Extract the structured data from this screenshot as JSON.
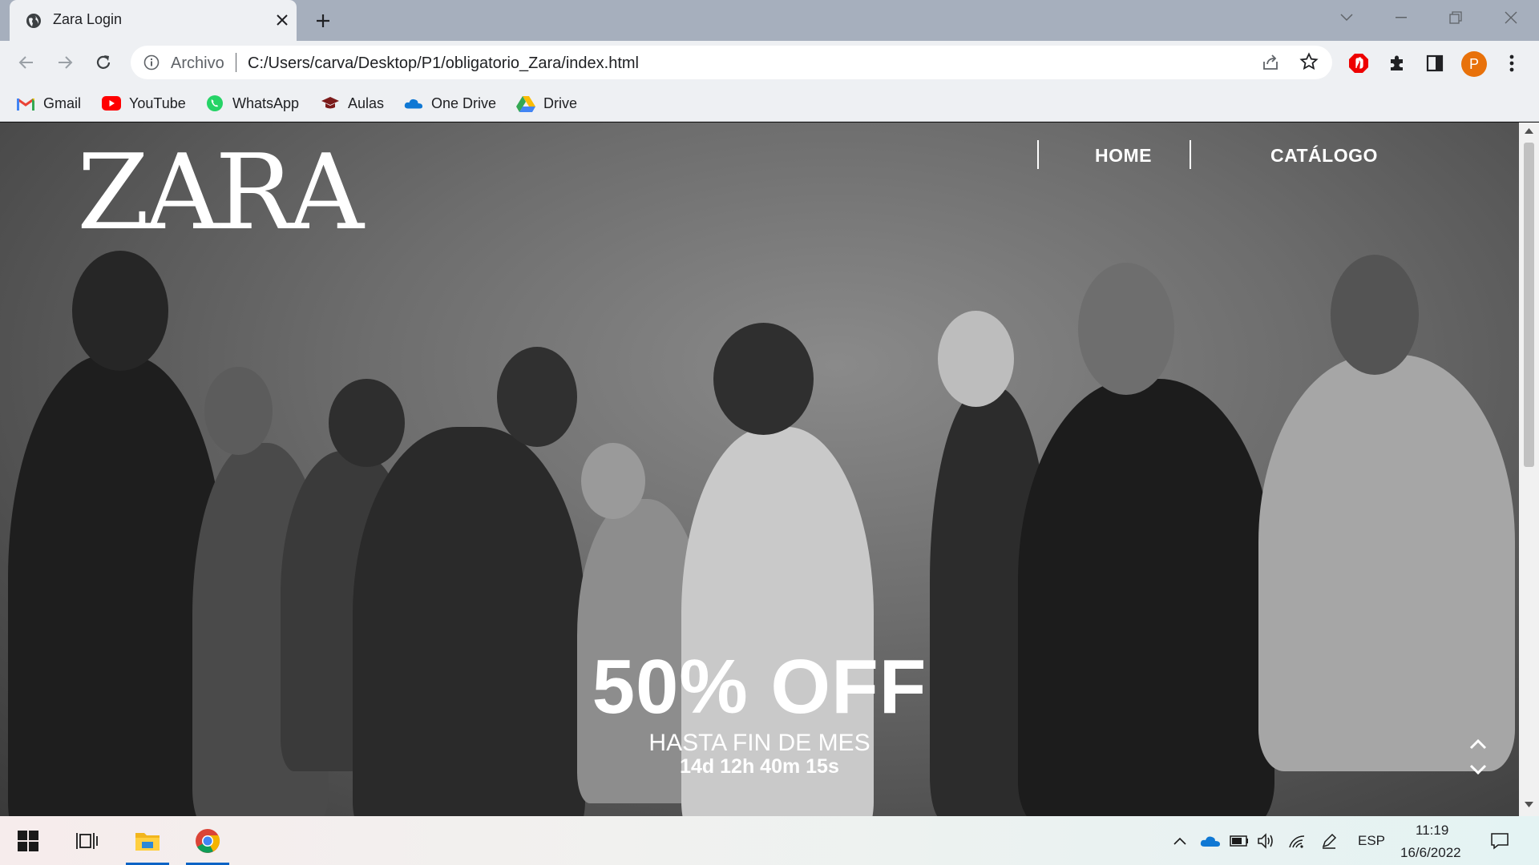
{
  "browser": {
    "tab_title": "Zara Login",
    "address_scheme": "Archivo",
    "address_url": "C:/Users/carva/Desktop/P1/obligatorio_Zara/index.html",
    "profile_initial": "P",
    "bookmarks": [
      {
        "label": "Gmail",
        "icon": "gmail-icon"
      },
      {
        "label": "YouTube",
        "icon": "youtube-icon"
      },
      {
        "label": "WhatsApp",
        "icon": "whatsapp-icon"
      },
      {
        "label": "Aulas",
        "icon": "graduation-cap-icon"
      },
      {
        "label": "One Drive",
        "icon": "onedrive-icon"
      },
      {
        "label": "Drive",
        "icon": "google-drive-icon"
      }
    ]
  },
  "page": {
    "logo": "ZARA",
    "nav": [
      {
        "label": "HOME"
      },
      {
        "label": "CATÁLOGO"
      }
    ],
    "promo": {
      "headline": "50% OFF",
      "subtitle": "HASTA FIN DE MES",
      "countdown": "14d 12h 40m 15s"
    }
  },
  "taskbar": {
    "language": "ESP",
    "time": "11:19",
    "date": "16/6/2022"
  },
  "colors": {
    "tab_strip": "#a6afbd",
    "toolbar": "#eef0f3",
    "profile": "#e8710a",
    "promo_text": "#ffffff"
  }
}
